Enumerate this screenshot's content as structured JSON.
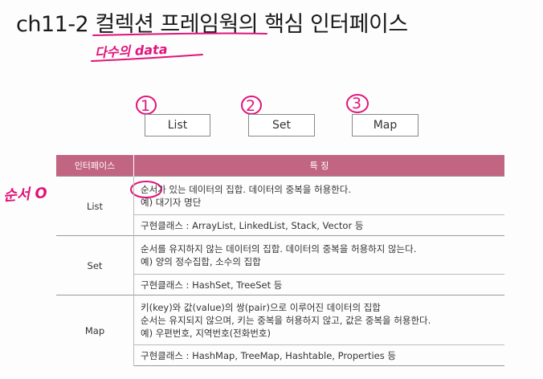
{
  "title": "ch11-2 컬렉션 프레임웍의 핵심 인터페이스",
  "annotations": {
    "data_note": "다수의 data",
    "order_note": "순서 O",
    "circle_1": "1",
    "circle_2": "2",
    "circle_3": "3",
    "ink_color": "#e0147a"
  },
  "interfaces": [
    "List",
    "Set",
    "Map"
  ],
  "table": {
    "headers": [
      "인터페이스",
      "특 징"
    ],
    "header_color": "#c26583",
    "rows": [
      {
        "name": "List",
        "desc": [
          "순서가 있는 데이터의 집합. 데이터의 중복을 허용한다.",
          "예) 대기자 명단"
        ],
        "classes": "구현클래스 : ArrayList, LinkedList, Stack, Vector 등"
      },
      {
        "name": "Set",
        "desc": [
          "순서를 유지하지 않는 데이터의 집합. 데이터의 중복을 허용하지 않는다.",
          "예) 양의 정수집합, 소수의 집합"
        ],
        "classes": "구현클래스 : HashSet, TreeSet 등"
      },
      {
        "name": "Map",
        "desc": [
          "키(key)와 값(value)의 쌍(pair)으로 이루어진 데이터의 집합",
          "순서는 유지되지 않으며, 키는 중복을 허용하지 않고, 값은 중복을 허용한다.",
          "예) 우편번호, 지역번호(전화번호)"
        ],
        "classes": "구현클래스 : HashMap, TreeMap, Hashtable, Properties 등"
      }
    ]
  }
}
